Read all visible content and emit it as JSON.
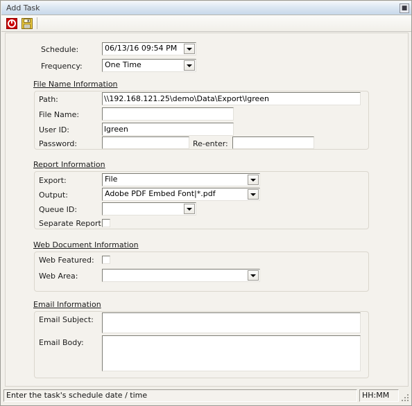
{
  "window": {
    "title": "Add Task",
    "close_icon": "close-icon"
  },
  "toolbar": {
    "cancel_icon": "cancel-icon",
    "save_icon": "save-icon"
  },
  "schedule_section": {
    "schedule_label": "Schedule:",
    "schedule_value": "06/13/16 09:54 PM",
    "frequency_label": "Frequency:",
    "frequency_value": "One Time"
  },
  "file_name_information": {
    "title": "File Name Information",
    "path_label": "Path:",
    "path_value": "\\\\192.168.121.25\\demo\\Data\\Export\\lgreen",
    "file_name_label": "File Name:",
    "file_name_value": "",
    "user_id_label": "User ID:",
    "user_id_value": "lgreen",
    "password_label": "Password:",
    "password_value": "",
    "reenter_label": "Re-enter:",
    "reenter_value": ""
  },
  "report_information": {
    "title": "Report Information",
    "export_label": "Export:",
    "export_value": "File",
    "output_label": "Output:",
    "output_value": "Adobe PDF Embed Font|*.pdf",
    "queue_id_label": "Queue ID:",
    "queue_id_value": "",
    "separate_report_label": "Separate Report :",
    "separate_report_checked": false
  },
  "web_document_information": {
    "title": "Web Document Information",
    "web_featured_label": "Web Featured:",
    "web_featured_checked": false,
    "web_area_label": "Web Area:",
    "web_area_value": ""
  },
  "email_information": {
    "title": "Email  Information",
    "email_subject_label": "Email Subject:",
    "email_subject_value": "",
    "email_body_label": "Email Body:",
    "email_body_value": ""
  },
  "statusbar": {
    "message": "Enter the task's schedule date / time",
    "time_format": "HH:MM"
  },
  "colors": {
    "titlebar_accent": "#c7d8ea",
    "window_background": "#f4f2ed",
    "cancel_icon_red": "#cc0000",
    "save_icon_yellow": "#e8c840"
  }
}
